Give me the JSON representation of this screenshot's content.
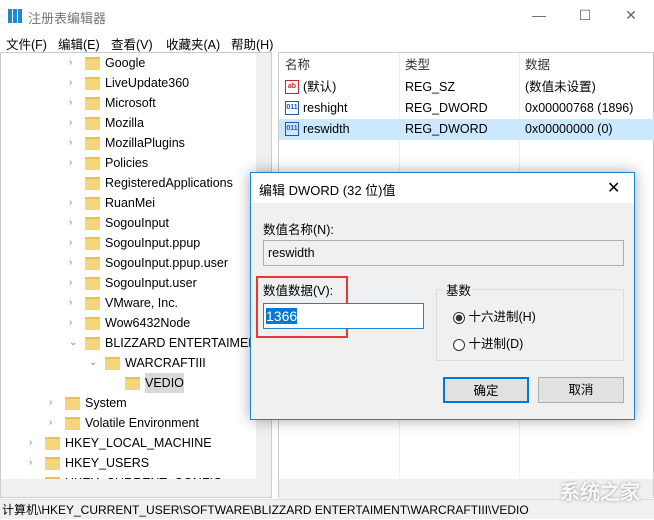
{
  "window": {
    "title": "注册表编辑器",
    "min": "—",
    "max": "☐",
    "close": "✕"
  },
  "menu": [
    "文件(F)",
    "编辑(E)",
    "查看(V)",
    "收藏夹(A)",
    "帮助(H)"
  ],
  "tree": [
    {
      "label": "Google",
      "level": 3,
      "chev": "›"
    },
    {
      "label": "LiveUpdate360",
      "level": 3,
      "chev": "›"
    },
    {
      "label": "Microsoft",
      "level": 3,
      "chev": "›"
    },
    {
      "label": "Mozilla",
      "level": 3,
      "chev": "›"
    },
    {
      "label": "MozillaPlugins",
      "level": 3,
      "chev": "›"
    },
    {
      "label": "Policies",
      "level": 3,
      "chev": "›"
    },
    {
      "label": "RegisteredApplications",
      "level": 3,
      "chev": ""
    },
    {
      "label": "RuanMei",
      "level": 3,
      "chev": "›"
    },
    {
      "label": "SogouInput",
      "level": 3,
      "chev": "›"
    },
    {
      "label": "SogouInput.ppup",
      "level": 3,
      "chev": "›"
    },
    {
      "label": "SogouInput.ppup.user",
      "level": 3,
      "chev": "›"
    },
    {
      "label": "SogouInput.user",
      "level": 3,
      "chev": "›"
    },
    {
      "label": "VMware, Inc.",
      "level": 3,
      "chev": "›"
    },
    {
      "label": "Wow6432Node",
      "level": 3,
      "chev": "›"
    },
    {
      "label": "BLIZZARD ENTERTAIMENT",
      "level": 3,
      "chev": "⌄"
    },
    {
      "label": "WARCRAFTIII",
      "level": 4,
      "chev": "⌄"
    },
    {
      "label": "VEDIO",
      "level": 5,
      "chev": ""
    },
    {
      "label": "System",
      "level": 2,
      "chev": "›"
    },
    {
      "label": "Volatile Environment",
      "level": 2,
      "chev": "›"
    },
    {
      "label": "HKEY_LOCAL_MACHINE",
      "level": 1,
      "chev": "›"
    },
    {
      "label": "HKEY_USERS",
      "level": 1,
      "chev": "›"
    },
    {
      "label": "HKEY_CURRENT_CONFIG",
      "level": 1,
      "chev": "›"
    }
  ],
  "list": {
    "headers": [
      "名称",
      "类型",
      "数据"
    ],
    "rows": [
      {
        "icon": "ab",
        "name": "(默认)",
        "type": "REG_SZ",
        "data": "(数值未设置)"
      },
      {
        "icon": "011",
        "name": "reshight",
        "type": "REG_DWORD",
        "data": "0x00000768 (1896)"
      },
      {
        "icon": "011",
        "name": "reswidth",
        "type": "REG_DWORD",
        "data": "0x00000000 (0)",
        "selected": true
      }
    ]
  },
  "status": "计算机\\HKEY_CURRENT_USER\\SOFTWARE\\BLIZZARD ENTERTAIMENT\\WARCRAFTIII\\VEDIO",
  "dialog": {
    "title": "编辑 DWORD (32 位)值",
    "close": "✕",
    "name_label": "数值名称(N):",
    "name_value": "reswidth",
    "data_label": "数值数据(V):",
    "data_value": "1366",
    "base_label": "基数",
    "hex": "十六进制(H)",
    "dec": "十进制(D)",
    "ok": "确定",
    "cancel": "取消"
  },
  "watermark": "系统之家"
}
